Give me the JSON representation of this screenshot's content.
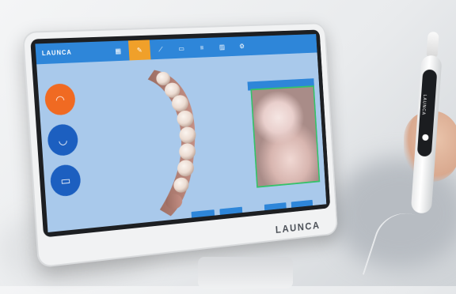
{
  "brand": {
    "screen_logo": "LAUNCA",
    "bezel_logo": "LAUNCA",
    "scanner_label": "LAUNCA"
  },
  "colors": {
    "screen_bg": "#a9c9eb",
    "topbar": "#2e86d9",
    "accent_orange": "#f06a22",
    "accent_blue": "#1c5fc0",
    "preview_border": "#35c26a"
  },
  "icons": {
    "tool_1": "report-icon",
    "tool_2": "pen-icon",
    "tool_3": "brush-icon",
    "tool_4": "monitor-icon",
    "tool_5": "layers-icon",
    "tool_6": "chart-icon",
    "tool_7": "gear-icon",
    "side_1": "tooth-icon",
    "side_2": "jaw-icon",
    "side_3": "bite-icon"
  }
}
